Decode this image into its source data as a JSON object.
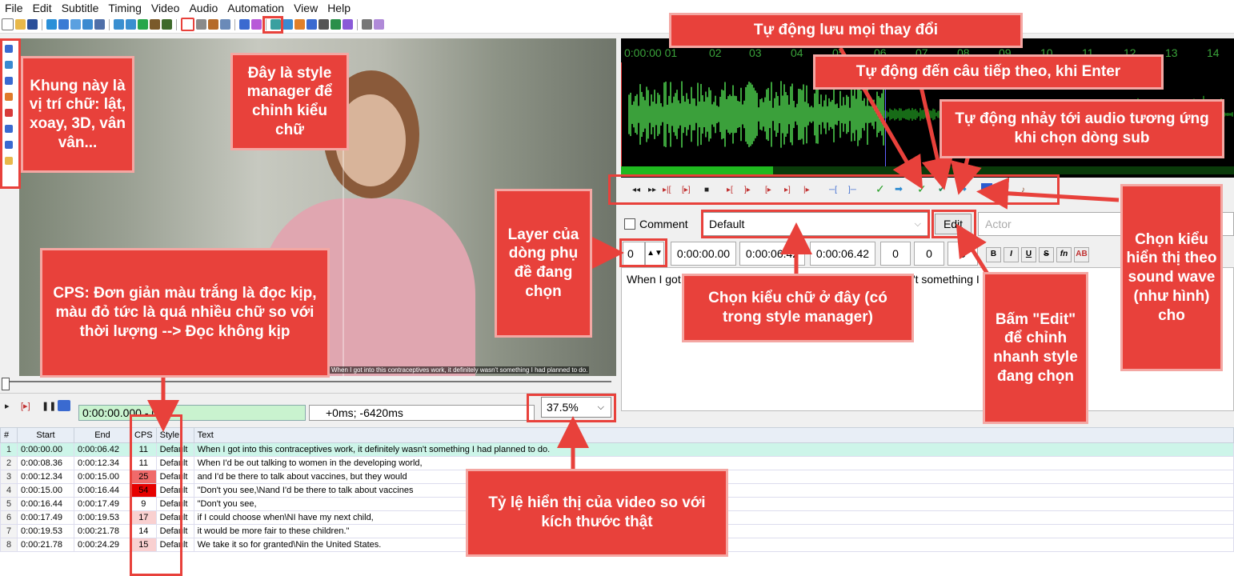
{
  "menu": [
    "File",
    "Edit",
    "Subtitle",
    "Timing",
    "Video",
    "Audio",
    "Automation",
    "View",
    "Help"
  ],
  "video": {
    "overlay_subtitle": "When I got into this contraceptives work, it definitely wasn't something I had planned to do.",
    "time": "0:00:00.000 - 0",
    "offset": "+0ms; -6420ms",
    "zoom": "37.5%"
  },
  "waveform": {
    "ruler": [
      "0:00:00 01",
      "02",
      "03",
      "04",
      "05",
      "06",
      "07",
      "08",
      "09",
      "10",
      "11",
      "12",
      "13",
      "14"
    ]
  },
  "editor": {
    "comment_label": "Comment",
    "style": "Default",
    "edit_label": "Edit",
    "actor_placeholder": "Actor",
    "layer": "0",
    "start": "0:00:00.00",
    "end": "0:00:06.42",
    "duration": "0:00:06.42",
    "margin_l": "0",
    "margin_r": "0",
    "margin_v": "0",
    "text": "When I got into this contraceptives work, it definitely wasn't something I had planned to do."
  },
  "grid": {
    "headers": [
      "#",
      "Start",
      "End",
      "CPS",
      "Style",
      "Text"
    ],
    "rows": [
      {
        "n": "1",
        "start": "0:00:00.00",
        "end": "0:00:06.42",
        "cps": "11",
        "style": "Default",
        "text": "When I got into this contraceptives work, it definitely wasn't something I had planned to do."
      },
      {
        "n": "2",
        "start": "0:00:08.36",
        "end": "0:00:12.34",
        "cps": "11",
        "style": "Default",
        "text": "When I'd be out talking to women in the developing world,"
      },
      {
        "n": "3",
        "start": "0:00:12.34",
        "end": "0:00:15.00",
        "cps": "25",
        "style": "Default",
        "text": "and I'd be there to talk about vaccines, but they would"
      },
      {
        "n": "4",
        "start": "0:00:15.00",
        "end": "0:00:16.44",
        "cps": "54",
        "style": "Default",
        "text": "\"Don't you see,\\Nand I'd be there to talk about vaccines"
      },
      {
        "n": "5",
        "start": "0:00:16.44",
        "end": "0:00:17.49",
        "cps": "9",
        "style": "Default",
        "text": "\"Don't you see,"
      },
      {
        "n": "6",
        "start": "0:00:17.49",
        "end": "0:00:19.53",
        "cps": "17",
        "style": "Default",
        "text": "if I could choose when\\NI have my next child,"
      },
      {
        "n": "7",
        "start": "0:00:19.53",
        "end": "0:00:21.78",
        "cps": "14",
        "style": "Default",
        "text": "it would be more fair to these children.\""
      },
      {
        "n": "8",
        "start": "0:00:21.78",
        "end": "0:00:24.29",
        "cps": "15",
        "style": "Default",
        "text": "We take it so for granted\\Nin the United States."
      }
    ]
  },
  "callouts": {
    "position_tools": "Khung này là vị trí chữ: lật, xoay, 3D, vân vân...",
    "style_manager": "Đây là style manager để chỉnh kiểu chữ",
    "autosave": "Tự động lưu mọi thay đổi",
    "auto_next": "Tự động đến câu tiếp theo, khi Enter",
    "auto_seek": "Tự động nhảy tới audio tương ứng khi chọn dòng sub",
    "spectrum": "Chọn kiểu hiển thị theo sound wave (như hình) cho",
    "layer": "Layer của dòng phụ đề đang chọn",
    "choose_style": "Chọn kiểu chữ ở đây (có trong style manager)",
    "edit_style": "Bấm \"Edit\" để chỉnh nhanh style đang chọn",
    "cps": "CPS: Đơn giản màu trắng là đọc kịp, màu đỏ tức là quá nhiều chữ so với thời lượng --> Đọc không kịp",
    "zoom": "Tỷ lệ hiển thị của video so với kích thước thật"
  }
}
